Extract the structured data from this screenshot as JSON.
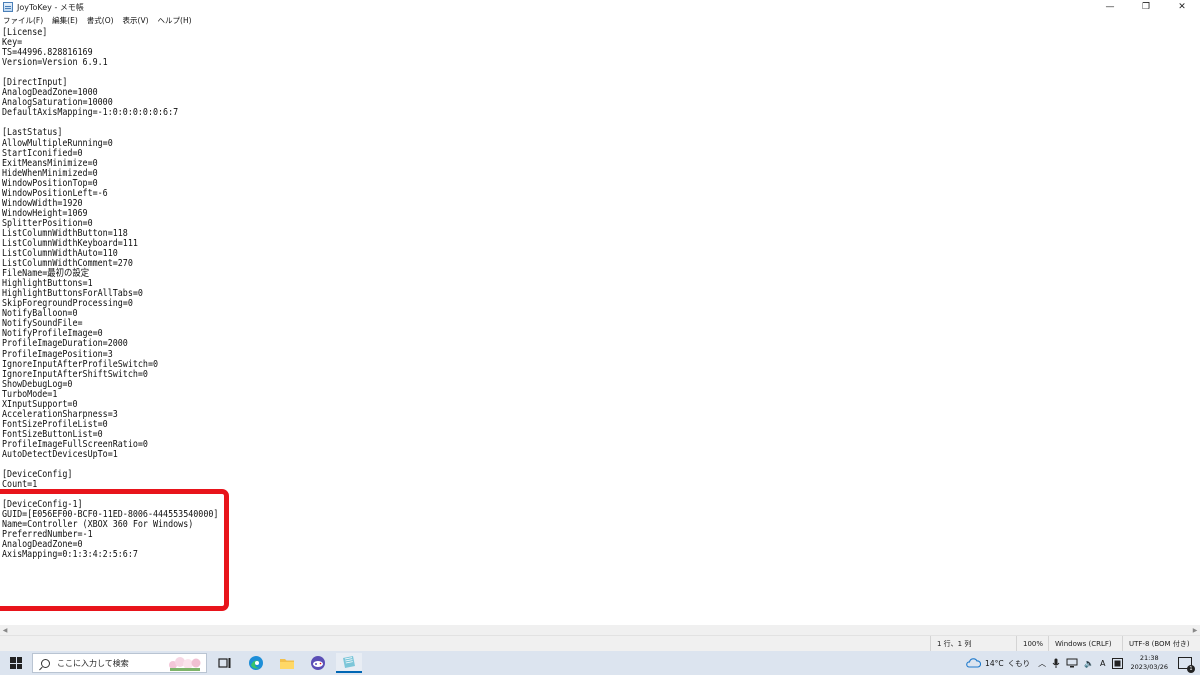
{
  "window": {
    "title": "JoyToKey - メモ帳",
    "minimize_glyph": "—",
    "maximize_glyph": "❐",
    "close_glyph": "✕"
  },
  "menu": [
    {
      "label": "ファイル(F)"
    },
    {
      "label": "編集(E)"
    },
    {
      "label": "書式(O)"
    },
    {
      "label": "表示(V)"
    },
    {
      "label": "ヘルプ(H)"
    }
  ],
  "document": {
    "lines": [
      "[License]",
      "Key=",
      "TS=44996.828816169",
      "Version=Version 6.9.1",
      "",
      "[DirectInput]",
      "AnalogDeadZone=1000",
      "AnalogSaturation=10000",
      "DefaultAxisMapping=-1:0:0:0:0:0:6:7",
      "",
      "[LastStatus]",
      "AllowMultipleRunning=0",
      "StartIconified=0",
      "ExitMeansMinimize=0",
      "HideWhenMinimized=0",
      "WindowPositionTop=0",
      "WindowPositionLeft=-6",
      "WindowWidth=1920",
      "WindowHeight=1069",
      "SplitterPosition=0",
      "ListColumnWidthButton=118",
      "ListColumnWidthKeyboard=111",
      "ListColumnWidthAuto=110",
      "ListColumnWidthComment=270",
      "FileName=最初の設定",
      "HighlightButtons=1",
      "HighlightButtonsForAllTabs=0",
      "SkipForegroundProcessing=0",
      "NotifyBalloon=0",
      "NotifySoundFile=",
      "NotifyProfileImage=0",
      "ProfileImageDuration=2000",
      "ProfileImagePosition=3",
      "IgnoreInputAfterProfileSwitch=0",
      "IgnoreInputAfterShiftSwitch=0",
      "ShowDebugLog=0",
      "TurboMode=1",
      "XInputSupport=0",
      "AccelerationSharpness=3",
      "FontSizeProfileList=0",
      "FontSizeButtonList=0",
      "ProfileImageFullScreenRatio=0",
      "AutoDetectDevicesUpTo=1",
      "",
      "[DeviceConfig]",
      "Count=1",
      "",
      "[DeviceConfig-1]",
      "GUID=[E056EF00-BCF0-11ED-8006-444553540000]",
      "Name=Controller (XBOX 360 For Windows)",
      "PreferredNumber=-1",
      "AnalogDeadZone=0",
      "AxisMapping=0:1:3:4:2:5:6:7"
    ]
  },
  "statusbar": {
    "position": "1 行、1 列",
    "zoom": "100%",
    "line_ending": "Windows (CRLF)",
    "encoding": "UTF-8 (BOM 付き)"
  },
  "taskbar": {
    "search_placeholder": "ここに入力して検索",
    "weather_temp": "14°C",
    "weather_cond": "くもり",
    "ime": "A",
    "time": "21:38",
    "date": "2023/03/26",
    "notification_count": "1"
  },
  "colors": {
    "annotation": "#e8141b",
    "taskbar_bg": "#dce4ef",
    "active_indicator": "#0066b4"
  }
}
